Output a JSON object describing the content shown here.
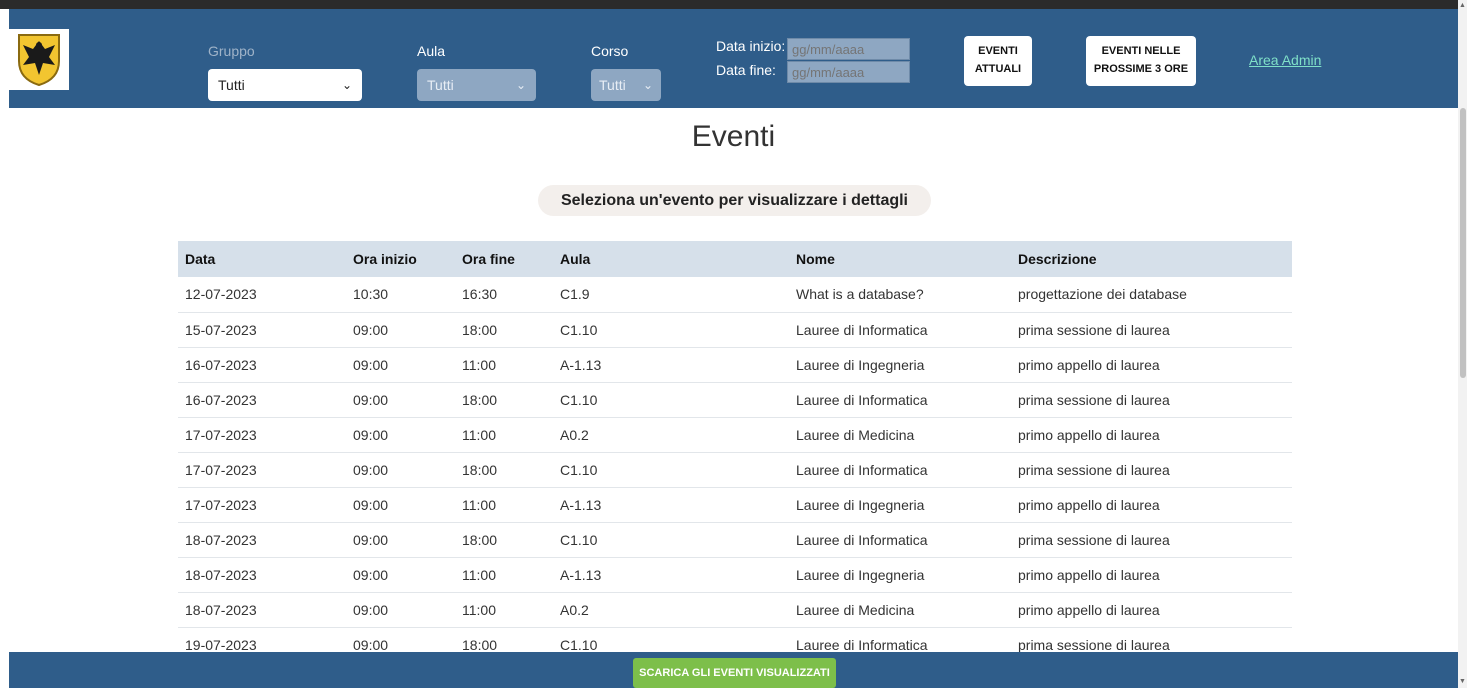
{
  "filters": {
    "gruppo": {
      "label": "Gruppo",
      "value": "Tutti"
    },
    "aula": {
      "label": "Aula",
      "value": "Tutti"
    },
    "corso": {
      "label": "Corso",
      "value": "Tutti"
    },
    "data_inizio": {
      "label": "Data inizio:",
      "placeholder": "gg/mm/aaaa"
    },
    "data_fine": {
      "label": "Data fine:",
      "placeholder": "gg/mm/aaaa"
    }
  },
  "buttons": {
    "eventi_attuali": [
      "EVENTI",
      "ATTUALI"
    ],
    "prossime": [
      "EVENTI NELLE",
      "PROSSIME 3 ORE"
    ],
    "admin": "Area Admin",
    "download": "SCARICA GLI EVENTI VISUALIZZATI"
  },
  "page": {
    "title": "Eventi",
    "subtitle": "Seleziona un'evento per visualizzare i dettagli"
  },
  "table": {
    "headers": [
      "Data",
      "Ora inizio",
      "Ora fine",
      "Aula",
      "Nome",
      "Descrizione"
    ],
    "rows": [
      [
        "12-07-2023",
        "10:30",
        "16:30",
        "C1.9",
        "What is a database?",
        "progettazione dei database"
      ],
      [
        "15-07-2023",
        "09:00",
        "18:00",
        "C1.10",
        "Lauree di Informatica",
        "prima sessione di laurea"
      ],
      [
        "16-07-2023",
        "09:00",
        "11:00",
        "A-1.13",
        "Lauree di Ingegneria",
        "primo appello di laurea"
      ],
      [
        "16-07-2023",
        "09:00",
        "18:00",
        "C1.10",
        "Lauree di Informatica",
        "prima sessione di laurea"
      ],
      [
        "17-07-2023",
        "09:00",
        "11:00",
        "A0.2",
        "Lauree di Medicina",
        "primo appello di laurea"
      ],
      [
        "17-07-2023",
        "09:00",
        "18:00",
        "C1.10",
        "Lauree di Informatica",
        "prima sessione di laurea"
      ],
      [
        "17-07-2023",
        "09:00",
        "11:00",
        "A-1.13",
        "Lauree di Ingegneria",
        "primo appello di laurea"
      ],
      [
        "18-07-2023",
        "09:00",
        "18:00",
        "C1.10",
        "Lauree di Informatica",
        "prima sessione di laurea"
      ],
      [
        "18-07-2023",
        "09:00",
        "11:00",
        "A-1.13",
        "Lauree di Ingegneria",
        "primo appello di laurea"
      ],
      [
        "18-07-2023",
        "09:00",
        "11:00",
        "A0.2",
        "Lauree di Medicina",
        "primo appello di laurea"
      ],
      [
        "19-07-2023",
        "09:00",
        "18:00",
        "C1.10",
        "Lauree di Informatica",
        "prima sessione di laurea"
      ]
    ]
  },
  "icons": {
    "logo": "university-eagle-crest-icon",
    "chevron": "chevron-down-icon"
  },
  "colors": {
    "header": "#2f5d8a",
    "download_button": "#7dbf4a",
    "admin_link": "#7fe0c8",
    "table_header": "#d6e0ea"
  }
}
